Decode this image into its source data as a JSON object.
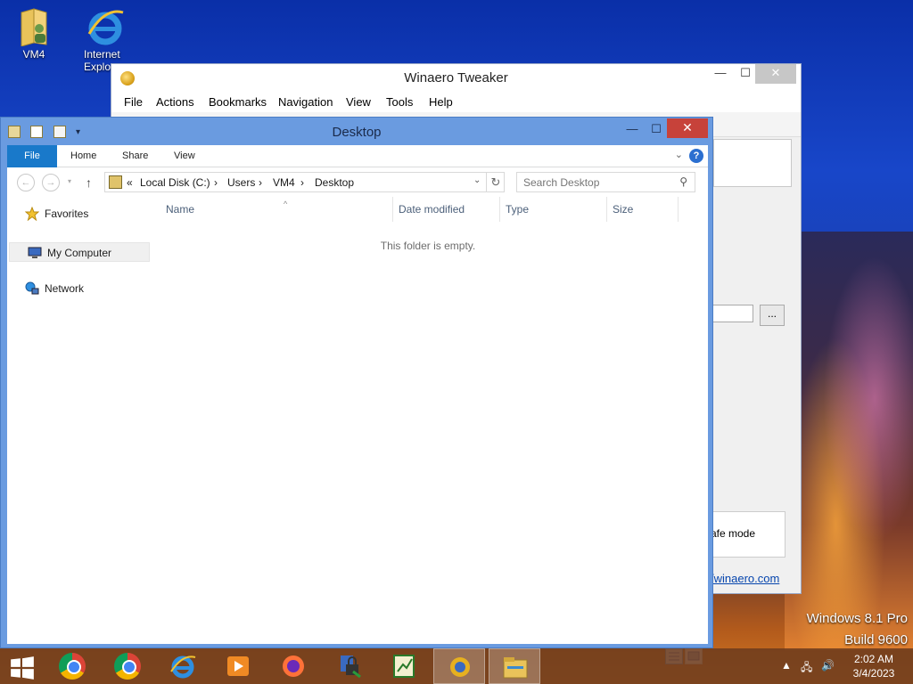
{
  "desktop": {
    "icons": [
      {
        "label": "VM4",
        "icon": "user-folder-icon"
      },
      {
        "label": "Internet Explorer",
        "icon": "internet-explorer-icon"
      }
    ],
    "os_name": "Windows 8.1 Pro",
    "build": "Build 9600"
  },
  "winaero": {
    "title": "Winaero Tweaker",
    "menu": [
      "File",
      "Actions",
      "Bookmarks",
      "Navigation",
      "View",
      "Tools",
      "Help"
    ],
    "dots_label": "...",
    "safe_mode_text": "afe mode",
    "link_text": "/winaero.com",
    "close_glyph": "✕",
    "min_glyph": "—",
    "max_glyph": "☐"
  },
  "explorer": {
    "title": "Desktop",
    "ribbon_tabs": [
      "File",
      "Home",
      "Share",
      "View"
    ],
    "help_glyph": "?",
    "breadcrumb": [
      "«",
      "Local Disk (C:)",
      "›",
      "Users",
      "›",
      "VM4",
      "›",
      "Desktop"
    ],
    "search_placeholder": "Search Desktop",
    "nav_items": [
      "Favorites",
      "My Computer",
      "Network"
    ],
    "columns": [
      "Name",
      "Date modified",
      "Type",
      "Size"
    ],
    "empty_message": "This folder is empty."
  },
  "taskbar": {
    "time": "2:02 AM",
    "date": "3/4/2023",
    "apps": [
      "chrome-icon",
      "chrome-icon",
      "internet-explorer-icon",
      "media-player-icon",
      "firefox-icon",
      "lock-tool-icon",
      "chart-app-icon",
      "winaero-tweaker-icon",
      "file-explorer-icon"
    ]
  },
  "colors": {
    "explorer_frame": "#6a9be0",
    "file_tab": "#1979ca",
    "close_red": "#c7423a"
  }
}
